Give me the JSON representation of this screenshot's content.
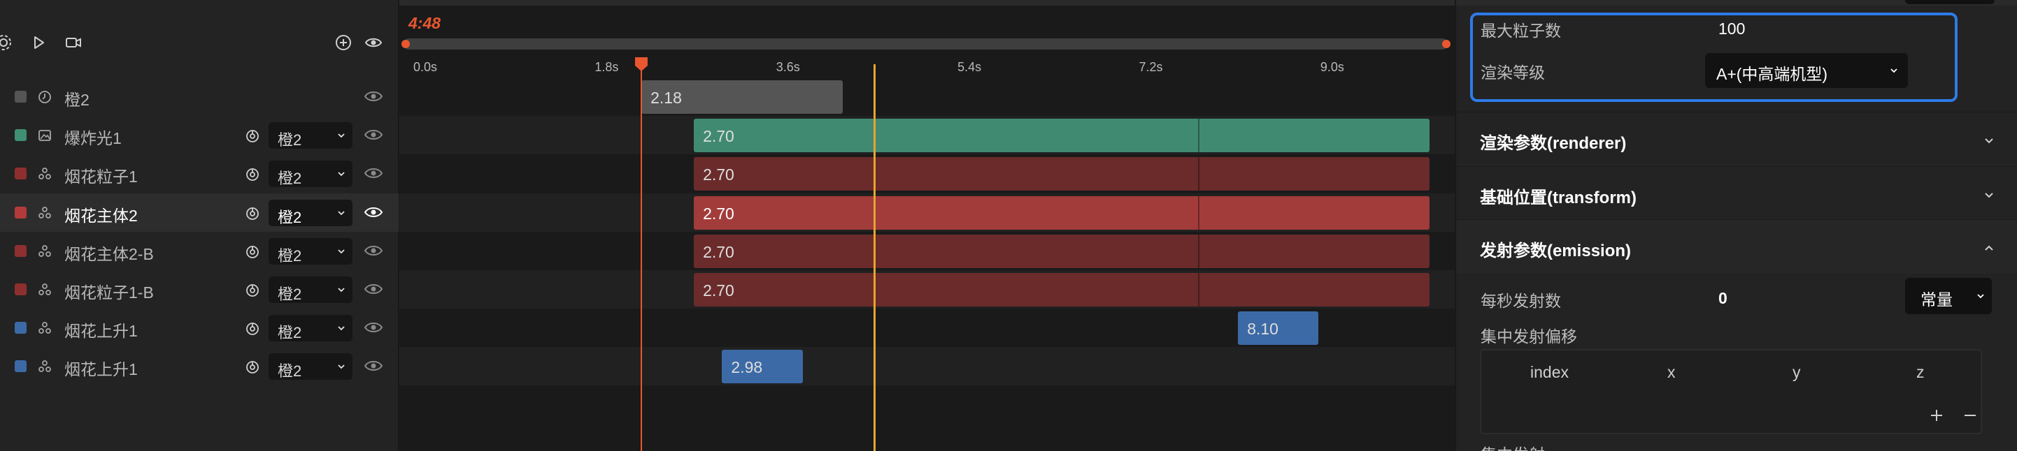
{
  "toolbar": {
    "icons": [
      "settings-icon",
      "play-icon",
      "camera-icon",
      "add-icon",
      "eye-icon"
    ]
  },
  "layers": [
    {
      "name": "橙2",
      "swatch": "#555555",
      "type_icon": "clock-icon",
      "has_select": false,
      "select": "",
      "selected": false
    },
    {
      "name": "爆炸光1",
      "swatch": "#3f8f73",
      "type_icon": "image-icon",
      "has_select": true,
      "select": "橙2",
      "selected": false
    },
    {
      "name": "烟花粒子1",
      "swatch": "#8e2f2f",
      "type_icon": "particle-icon",
      "has_select": true,
      "select": "橙2",
      "selected": false
    },
    {
      "name": "烟花主体2",
      "swatch": "#b33a3a",
      "type_icon": "particle-icon",
      "has_select": true,
      "select": "橙2",
      "selected": true
    },
    {
      "name": "烟花主体2-B",
      "swatch": "#8e2f2f",
      "type_icon": "particle-icon",
      "has_select": true,
      "select": "橙2",
      "selected": false
    },
    {
      "name": "烟花粒子1-B",
      "swatch": "#8e2f2f",
      "type_icon": "particle-icon",
      "has_select": true,
      "select": "橙2",
      "selected": false
    },
    {
      "name": "烟花上升1",
      "swatch": "#3c6aa6",
      "type_icon": "particle-icon",
      "has_select": true,
      "select": "橙2",
      "selected": false
    },
    {
      "name": "烟花上升1",
      "swatch": "#3c6aa6",
      "type_icon": "particle-icon",
      "has_select": true,
      "select": "橙2",
      "selected": false
    }
  ],
  "timeline": {
    "current_time": "4:48",
    "ticks": [
      "0.0s",
      "1.8s",
      "3.6s",
      "5.4s",
      "7.2s",
      "9.0s"
    ],
    "tick_values": [
      0,
      1.8,
      3.6,
      5.4,
      7.2,
      9.0
    ],
    "view_end": 10.0,
    "playhead_time": 2.18,
    "clips": [
      {
        "label": "2.18",
        "start": 2.18,
        "end": 4.18,
        "color": "#555555",
        "split": null
      },
      {
        "label": "2.70",
        "start": 2.7,
        "end": 10.0,
        "color": "#408a72",
        "split": 7.7
      },
      {
        "label": "2.70",
        "start": 2.7,
        "end": 10.0,
        "color": "#6b2b2b",
        "split": 7.7
      },
      {
        "label": "2.70",
        "start": 2.7,
        "end": 10.0,
        "color": "#a23c3a",
        "split": 7.7
      },
      {
        "label": "2.70",
        "start": 2.7,
        "end": 10.0,
        "color": "#6b2b2b",
        "split": 7.7
      },
      {
        "label": "2.70",
        "start": 2.7,
        "end": 10.0,
        "color": "#6b2b2b",
        "split": 7.7
      },
      {
        "label": "8.10",
        "start": 8.1,
        "end": 8.9,
        "color": "#3c6aa6",
        "split": null
      },
      {
        "label": "2.98",
        "start": 2.98,
        "end": 3.78,
        "color": "#3c6aa6",
        "split": null
      }
    ]
  },
  "props": {
    "max_particles_label": "最大粒子数",
    "max_particles_value": "100",
    "render_level_label": "渲染等级",
    "render_level_value": "A+(中高端机型)",
    "sections": [
      {
        "title": "渲染参数(renderer)",
        "expanded": false
      },
      {
        "title": "基础位置(transform)",
        "expanded": false
      },
      {
        "title": "发射参数(emission)",
        "expanded": true
      }
    ],
    "rate_label": "每秒发射数",
    "rate_value": "0",
    "rate_mode": "常量",
    "burst_offset_label": "集中发射偏移",
    "vec_columns": [
      "index",
      "x",
      "y",
      "z"
    ],
    "next_label": "集中发射"
  },
  "colors": {
    "accent": "#e8572f",
    "cursor": "#e8a52f",
    "focus": "#2f7be8"
  }
}
